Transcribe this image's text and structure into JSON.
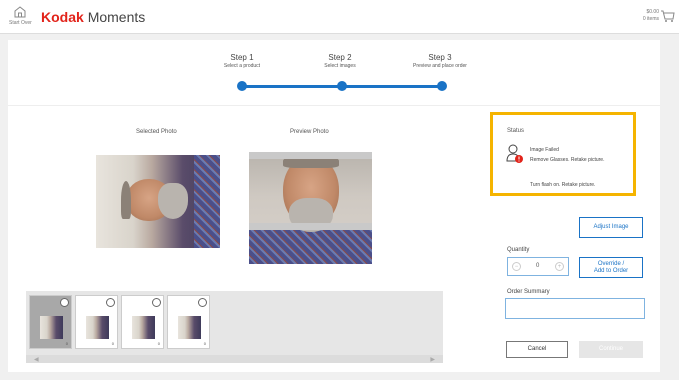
{
  "header": {
    "home_label": "Start Over",
    "brand_kodak": "Kodak",
    "brand_moments": "Moments",
    "cart_total": "$0.00",
    "cart_items": "0 items"
  },
  "steps": [
    {
      "title": "Step 1",
      "subtitle": "Select a product"
    },
    {
      "title": "Step 2",
      "subtitle": "Select images"
    },
    {
      "title": "Step 3",
      "subtitle": "Preview and place order"
    }
  ],
  "photos": {
    "selected_label": "Selected Photo",
    "preview_label": "Preview Photo"
  },
  "status": {
    "title": "Status",
    "line1": "Image Failed",
    "line2": "Remove Glasses. Retake picture.",
    "line3": "Turn flash on. Retake picture."
  },
  "actions": {
    "adjust_label": "Adjust Image",
    "quantity_label": "Quantity",
    "quantity_value": "0",
    "override_line1": "Override /",
    "override_line2": "Add to Order",
    "order_summary_label": "Order Summary",
    "cancel_label": "Cancel",
    "continue_label": "Continue"
  },
  "thumbnails": [
    {
      "selected": true,
      "badge": "0"
    },
    {
      "selected": false,
      "badge": "0"
    },
    {
      "selected": false,
      "badge": "0"
    },
    {
      "selected": false,
      "badge": "0"
    }
  ],
  "colors": {
    "accent": "#1a73c6",
    "highlight": "#f5b400",
    "brand": "#e2231a",
    "error": "#e2231a"
  }
}
